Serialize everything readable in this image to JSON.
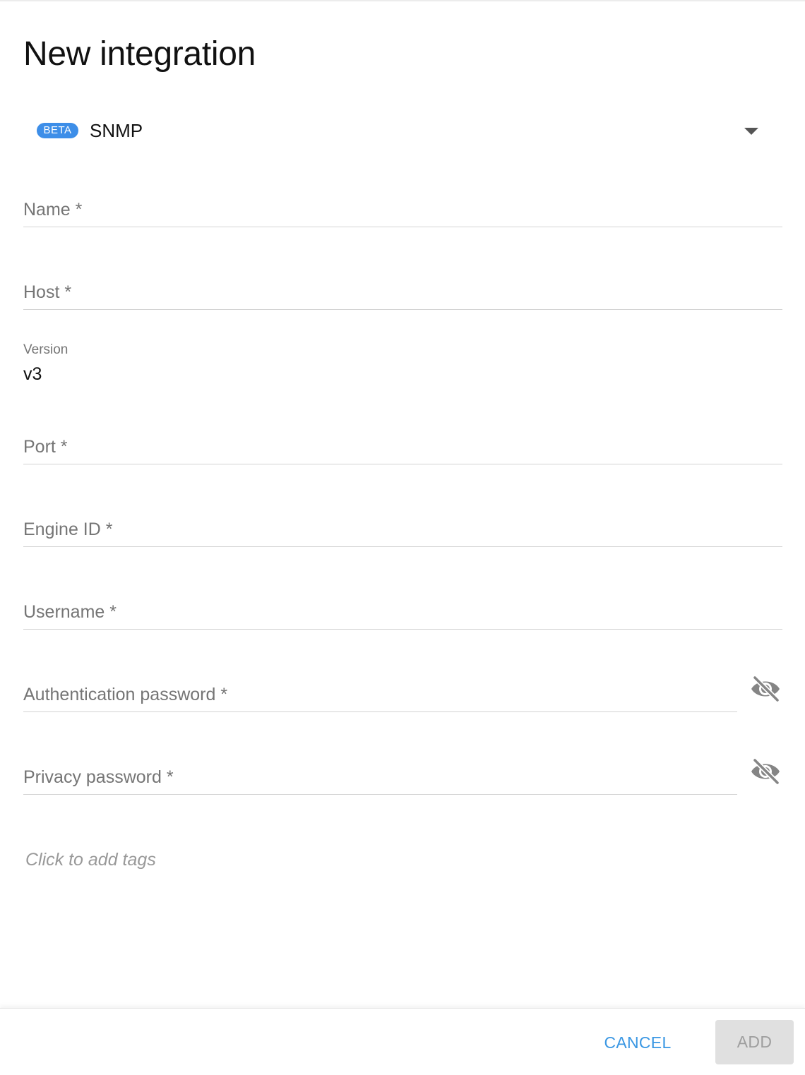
{
  "dialog": {
    "title": "New integration"
  },
  "type_select": {
    "badge": "BETA",
    "value": "SNMP"
  },
  "fields": {
    "name": "Name *",
    "host": "Host *",
    "port": "Port *",
    "engine_id": "Engine ID *",
    "username": "Username *",
    "auth_password": "Authentication password *",
    "privacy_password": "Privacy password *"
  },
  "version": {
    "label": "Version",
    "value": "v3"
  },
  "tags": {
    "placeholder": "Click to add tags"
  },
  "footer": {
    "cancel_label": "CANCEL",
    "add_label": "ADD"
  },
  "icons": {
    "password_toggle": "eye-off-icon",
    "dropdown": "chevron-down-icon"
  },
  "colors": {
    "accent": "#3a97e3",
    "badge": "#3d8ee8",
    "disabled_bg": "#e0e0e0"
  }
}
